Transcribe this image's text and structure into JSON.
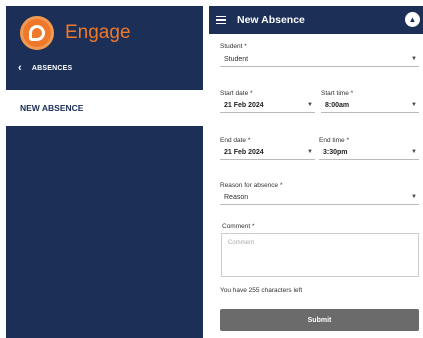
{
  "sidebar": {
    "brand_name": "Engage",
    "back_label": "ABSENCES",
    "active_item": "NEW ABSENCE"
  },
  "header": {
    "title": "New Absence"
  },
  "form": {
    "student": {
      "label": "Student *",
      "value": "Student"
    },
    "start_date": {
      "label": "Start date *",
      "value": "21 Feb 2024"
    },
    "start_time": {
      "label": "Start time *",
      "value": "8:00am"
    },
    "end_date": {
      "label": "End date *",
      "value": "21 Feb 2024"
    },
    "end_time": {
      "label": "End time *",
      "value": "3:30pm"
    },
    "reason": {
      "label": "Reason for absence *",
      "value": "Reason"
    },
    "comment": {
      "label": "Comment *",
      "placeholder": "Comment"
    },
    "counter_text": "You have 255 characters left",
    "submit_label": "Submit"
  },
  "colors": {
    "navy": "#1b2f57",
    "orange": "#f0782a",
    "button_grey": "#6b6b6b"
  },
  "icons": [
    "engage-logo-icon",
    "chevron-left-icon",
    "hamburger-menu-icon",
    "bell-icon",
    "chevron-down-icon"
  ]
}
